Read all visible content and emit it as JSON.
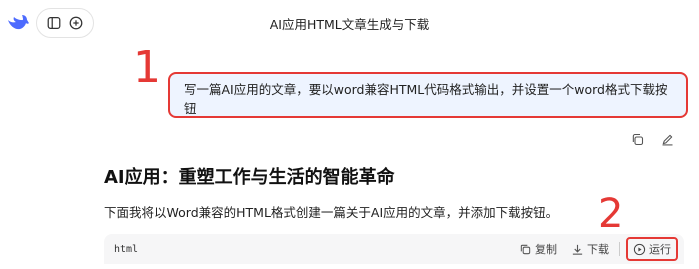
{
  "header": {
    "title": "AI应用HTML文章生成与下载"
  },
  "annotations": {
    "first": "1",
    "second": "2"
  },
  "user_message": {
    "text": "写一篇AI应用的文章，要以word兼容HTML代码格式输出，并设置一个word格式下载按钮"
  },
  "reply": {
    "title": "AI应用：重塑工作与生活的智能革命",
    "paragraph": "下面我将以Word兼容的HTML格式创建一篇关于AI应用的文章，并添加下载按钮。"
  },
  "code_block": {
    "language": "html",
    "copy_label": "复制",
    "download_label": "下载",
    "run_label": "运行"
  },
  "colors": {
    "annotation": "#e53935",
    "user_bubble": "#eef4ff",
    "brand": "#4d6bfe"
  },
  "icons": [
    "deepseek-logo",
    "sidebar-toggle-icon",
    "new-chat-icon",
    "copy-icon",
    "edit-icon",
    "download-icon",
    "play-icon"
  ]
}
